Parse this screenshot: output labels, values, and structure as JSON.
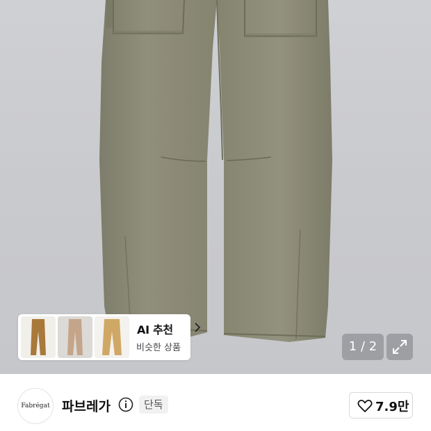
{
  "ai_recommend": {
    "title": "AI 추천",
    "subtitle": "비슷한 상품",
    "thumbnails": [
      {
        "name": "thumb-1",
        "color": "#a8793a"
      },
      {
        "name": "thumb-2",
        "color": "#c4a58a"
      },
      {
        "name": "thumb-3",
        "color": "#d0a866"
      }
    ]
  },
  "gallery": {
    "pager": "1 / 2",
    "product_color": "#8c8b78"
  },
  "brand": {
    "logo_text": "Fabrégat",
    "name": "파브레가",
    "badge": "단독",
    "like_count": "7.9만"
  },
  "icons": {
    "info": "info-icon",
    "heart": "heart-icon",
    "expand": "expand-icon",
    "chevron": "chevron-right-icon"
  }
}
